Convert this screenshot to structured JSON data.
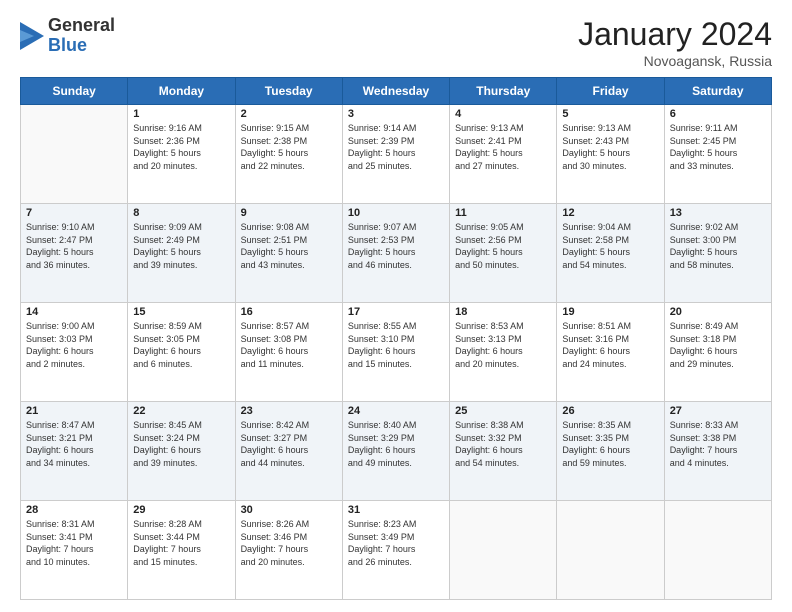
{
  "logo": {
    "general": "General",
    "blue": "Blue"
  },
  "header": {
    "month": "January 2024",
    "location": "Novoagansk, Russia"
  },
  "weekdays": [
    "Sunday",
    "Monday",
    "Tuesday",
    "Wednesday",
    "Thursday",
    "Friday",
    "Saturday"
  ],
  "weeks": [
    [
      {
        "day": "",
        "info": ""
      },
      {
        "day": "1",
        "info": "Sunrise: 9:16 AM\nSunset: 2:36 PM\nDaylight: 5 hours\nand 20 minutes."
      },
      {
        "day": "2",
        "info": "Sunrise: 9:15 AM\nSunset: 2:38 PM\nDaylight: 5 hours\nand 22 minutes."
      },
      {
        "day": "3",
        "info": "Sunrise: 9:14 AM\nSunset: 2:39 PM\nDaylight: 5 hours\nand 25 minutes."
      },
      {
        "day": "4",
        "info": "Sunrise: 9:13 AM\nSunset: 2:41 PM\nDaylight: 5 hours\nand 27 minutes."
      },
      {
        "day": "5",
        "info": "Sunrise: 9:13 AM\nSunset: 2:43 PM\nDaylight: 5 hours\nand 30 minutes."
      },
      {
        "day": "6",
        "info": "Sunrise: 9:11 AM\nSunset: 2:45 PM\nDaylight: 5 hours\nand 33 minutes."
      }
    ],
    [
      {
        "day": "7",
        "info": "Sunrise: 9:10 AM\nSunset: 2:47 PM\nDaylight: 5 hours\nand 36 minutes."
      },
      {
        "day": "8",
        "info": "Sunrise: 9:09 AM\nSunset: 2:49 PM\nDaylight: 5 hours\nand 39 minutes."
      },
      {
        "day": "9",
        "info": "Sunrise: 9:08 AM\nSunset: 2:51 PM\nDaylight: 5 hours\nand 43 minutes."
      },
      {
        "day": "10",
        "info": "Sunrise: 9:07 AM\nSunset: 2:53 PM\nDaylight: 5 hours\nand 46 minutes."
      },
      {
        "day": "11",
        "info": "Sunrise: 9:05 AM\nSunset: 2:56 PM\nDaylight: 5 hours\nand 50 minutes."
      },
      {
        "day": "12",
        "info": "Sunrise: 9:04 AM\nSunset: 2:58 PM\nDaylight: 5 hours\nand 54 minutes."
      },
      {
        "day": "13",
        "info": "Sunrise: 9:02 AM\nSunset: 3:00 PM\nDaylight: 5 hours\nand 58 minutes."
      }
    ],
    [
      {
        "day": "14",
        "info": "Sunrise: 9:00 AM\nSunset: 3:03 PM\nDaylight: 6 hours\nand 2 minutes."
      },
      {
        "day": "15",
        "info": "Sunrise: 8:59 AM\nSunset: 3:05 PM\nDaylight: 6 hours\nand 6 minutes."
      },
      {
        "day": "16",
        "info": "Sunrise: 8:57 AM\nSunset: 3:08 PM\nDaylight: 6 hours\nand 11 minutes."
      },
      {
        "day": "17",
        "info": "Sunrise: 8:55 AM\nSunset: 3:10 PM\nDaylight: 6 hours\nand 15 minutes."
      },
      {
        "day": "18",
        "info": "Sunrise: 8:53 AM\nSunset: 3:13 PM\nDaylight: 6 hours\nand 20 minutes."
      },
      {
        "day": "19",
        "info": "Sunrise: 8:51 AM\nSunset: 3:16 PM\nDaylight: 6 hours\nand 24 minutes."
      },
      {
        "day": "20",
        "info": "Sunrise: 8:49 AM\nSunset: 3:18 PM\nDaylight: 6 hours\nand 29 minutes."
      }
    ],
    [
      {
        "day": "21",
        "info": "Sunrise: 8:47 AM\nSunset: 3:21 PM\nDaylight: 6 hours\nand 34 minutes."
      },
      {
        "day": "22",
        "info": "Sunrise: 8:45 AM\nSunset: 3:24 PM\nDaylight: 6 hours\nand 39 minutes."
      },
      {
        "day": "23",
        "info": "Sunrise: 8:42 AM\nSunset: 3:27 PM\nDaylight: 6 hours\nand 44 minutes."
      },
      {
        "day": "24",
        "info": "Sunrise: 8:40 AM\nSunset: 3:29 PM\nDaylight: 6 hours\nand 49 minutes."
      },
      {
        "day": "25",
        "info": "Sunrise: 8:38 AM\nSunset: 3:32 PM\nDaylight: 6 hours\nand 54 minutes."
      },
      {
        "day": "26",
        "info": "Sunrise: 8:35 AM\nSunset: 3:35 PM\nDaylight: 6 hours\nand 59 minutes."
      },
      {
        "day": "27",
        "info": "Sunrise: 8:33 AM\nSunset: 3:38 PM\nDaylight: 7 hours\nand 4 minutes."
      }
    ],
    [
      {
        "day": "28",
        "info": "Sunrise: 8:31 AM\nSunset: 3:41 PM\nDaylight: 7 hours\nand 10 minutes."
      },
      {
        "day": "29",
        "info": "Sunrise: 8:28 AM\nSunset: 3:44 PM\nDaylight: 7 hours\nand 15 minutes."
      },
      {
        "day": "30",
        "info": "Sunrise: 8:26 AM\nSunset: 3:46 PM\nDaylight: 7 hours\nand 20 minutes."
      },
      {
        "day": "31",
        "info": "Sunrise: 8:23 AM\nSunset: 3:49 PM\nDaylight: 7 hours\nand 26 minutes."
      },
      {
        "day": "",
        "info": ""
      },
      {
        "day": "",
        "info": ""
      },
      {
        "day": "",
        "info": ""
      }
    ]
  ]
}
